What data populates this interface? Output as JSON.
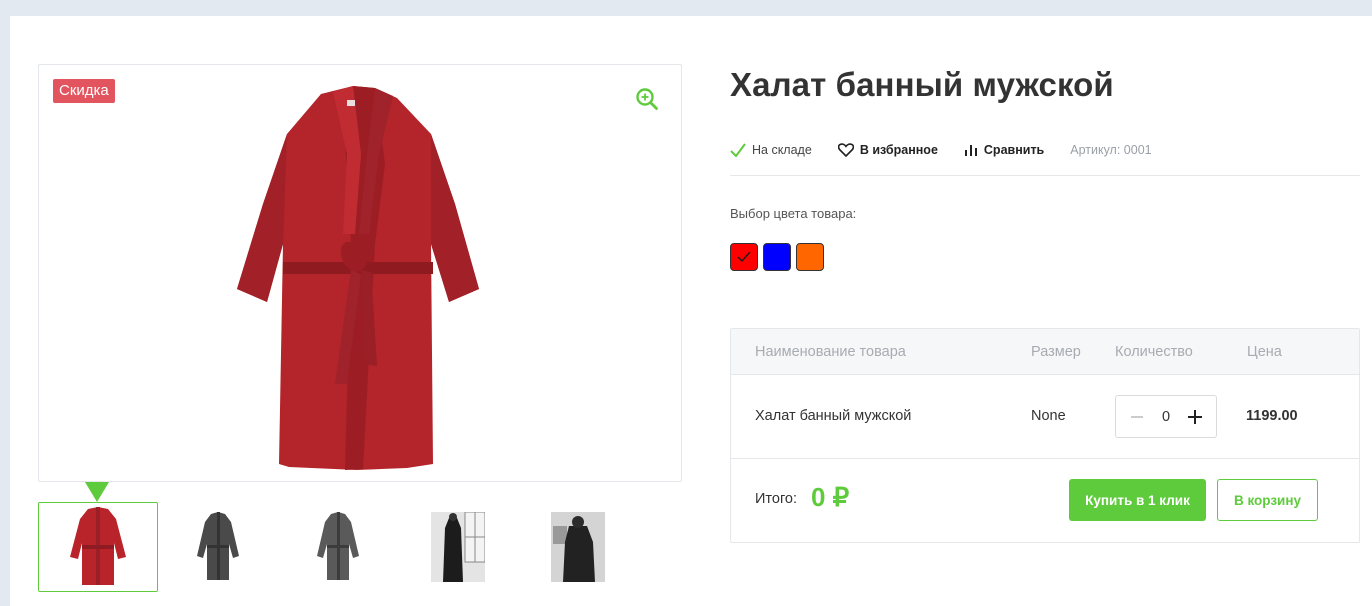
{
  "product": {
    "title": "Халат банный мужской",
    "badge": "Скидка",
    "image_icon": "zoom-in-icon"
  },
  "meta": {
    "stock": "На складе",
    "favorite": "В избранное",
    "compare": "Сравнить",
    "article": "Артикул: 0001"
  },
  "color_picker": {
    "label": "Выбор цвета товара:",
    "colors": [
      "#ff0000",
      "#0000ff",
      "#ff6600"
    ],
    "selected_index": 0
  },
  "thumbnails": [
    {
      "name": "red-robe",
      "color": "#b8242a",
      "active": true
    },
    {
      "name": "grey-robe-1",
      "color": "#4a4a4a",
      "active": false
    },
    {
      "name": "grey-robe-2",
      "color": "#5a5a5a",
      "active": false
    },
    {
      "name": "photo-man-1",
      "color": "#1e1e1e",
      "active": false
    },
    {
      "name": "photo-man-2",
      "color": "#2a2a2a",
      "active": false
    }
  ],
  "order_table": {
    "headers": {
      "name": "Наименование товара",
      "size": "Размер",
      "quantity": "Количество",
      "price": "Цена"
    },
    "row": {
      "name": "Халат банный мужской",
      "size": "None",
      "quantity": "0",
      "price": "1199.00"
    },
    "total_label": "Итого:",
    "total_value": "0 ₽",
    "buy_one_click": "Купить в 1 клик",
    "add_to_cart": "В корзину"
  },
  "colors": {
    "accent": "#5ecb3c",
    "badge": "#e2555f",
    "background": "#e3e9f1"
  }
}
